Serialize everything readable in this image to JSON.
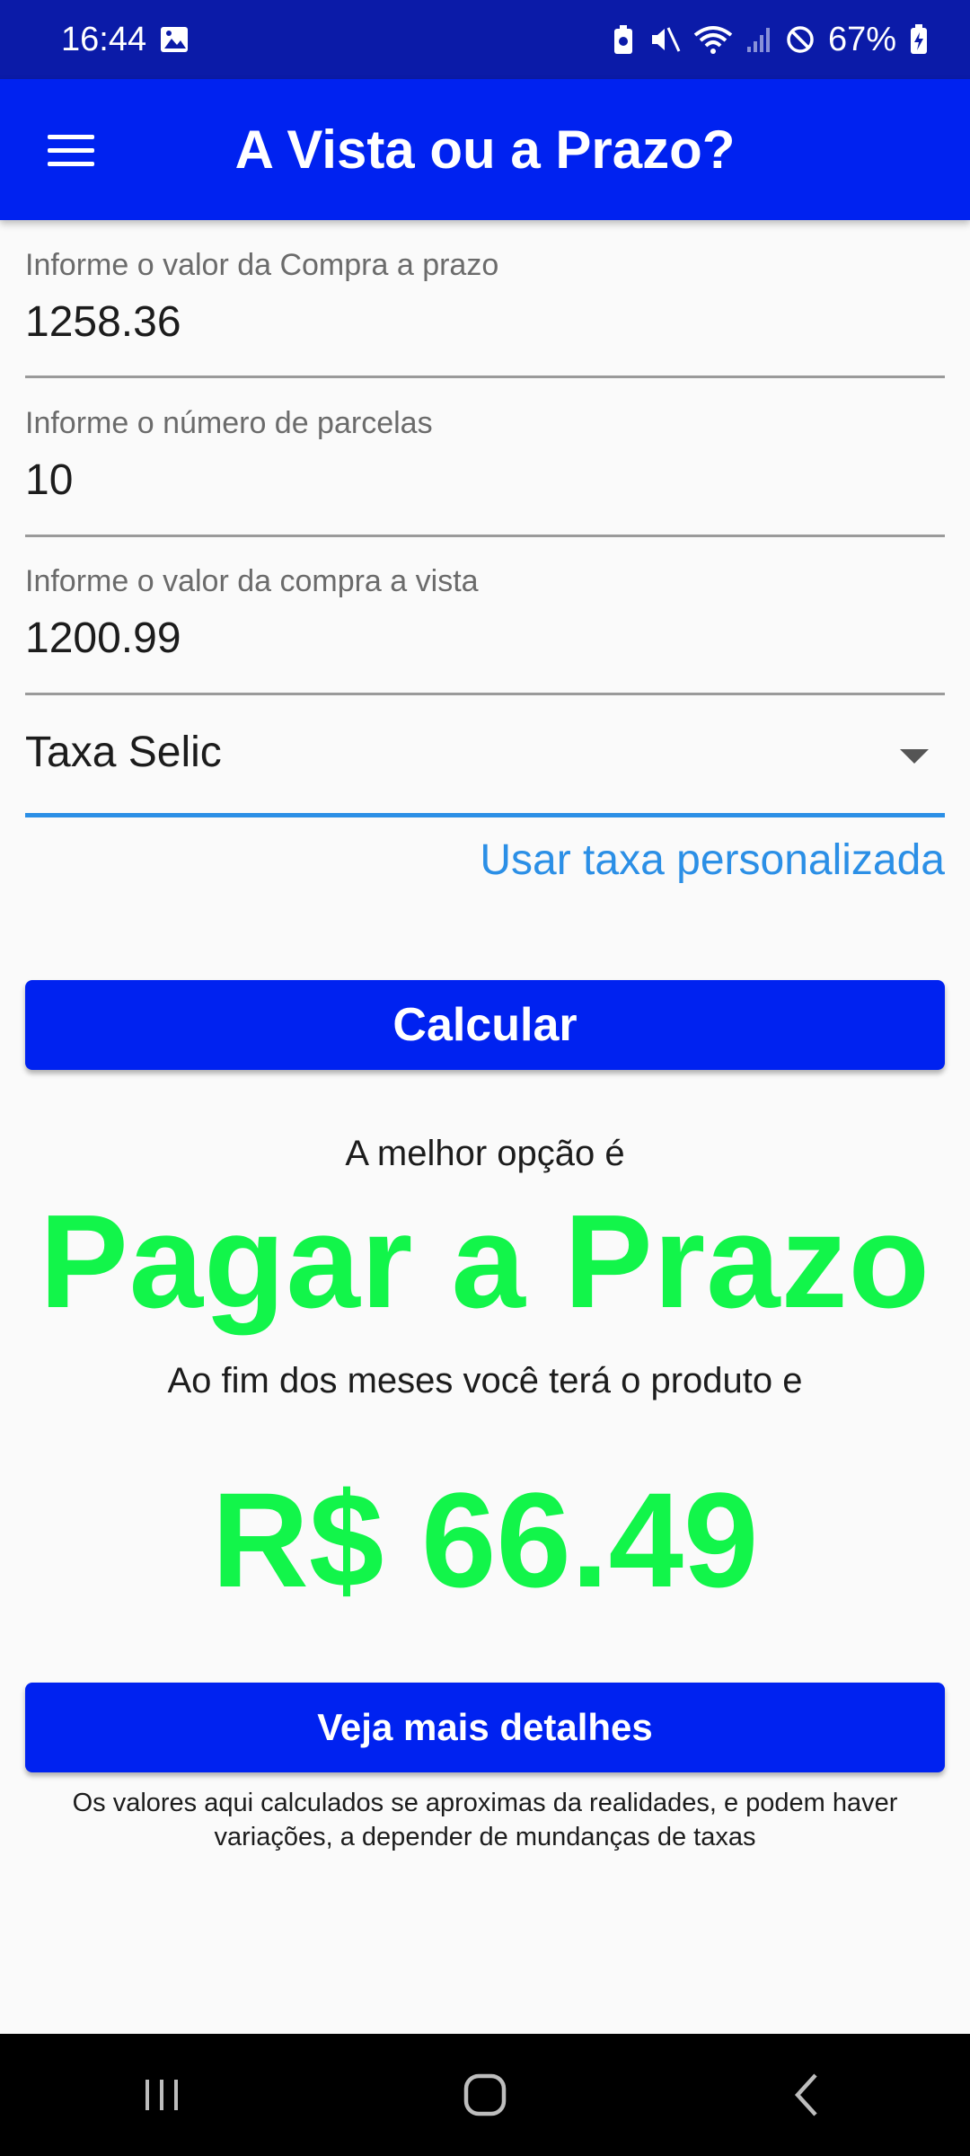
{
  "status_bar": {
    "time": "16:44",
    "battery": "67%",
    "icons": [
      "image-icon",
      "battery-saver-icon",
      "mute-icon",
      "wifi-icon",
      "signal-icon",
      "do-not-disturb-icon",
      "battery-icon"
    ]
  },
  "app_bar": {
    "title": "A Vista ou a Prazo?",
    "menu_icon": "menu-icon"
  },
  "form": {
    "installment_total": {
      "label": "Informe o valor da Compra a prazo",
      "value": "1258.36"
    },
    "installments": {
      "label": "Informe o número de parcelas",
      "value": "10"
    },
    "cash_price": {
      "label": "Informe o valor da compra a vista",
      "value": "1200.99"
    },
    "rate_select": {
      "value": "Taxa Selic"
    },
    "custom_rate_link": "Usar taxa personalizada",
    "calculate_label": "Calcular"
  },
  "result": {
    "intro": "A melhor opção é",
    "option": "Pagar a Prazo",
    "subtitle": "Ao fim dos meses você terá o produto e",
    "amount": "R$ 66.49",
    "details_label": "Veja mais detalhes",
    "disclaimer": "Os valores aqui calculados se aproximas da realidades, e podem haver variações, a depender de mundanças de taxas"
  },
  "colors": {
    "status_bar": "#0b1ba8",
    "app_bar": "#0022f0",
    "accent_link": "#2b8fe6",
    "result_green": "#12f54a",
    "background": "#fafafa"
  }
}
